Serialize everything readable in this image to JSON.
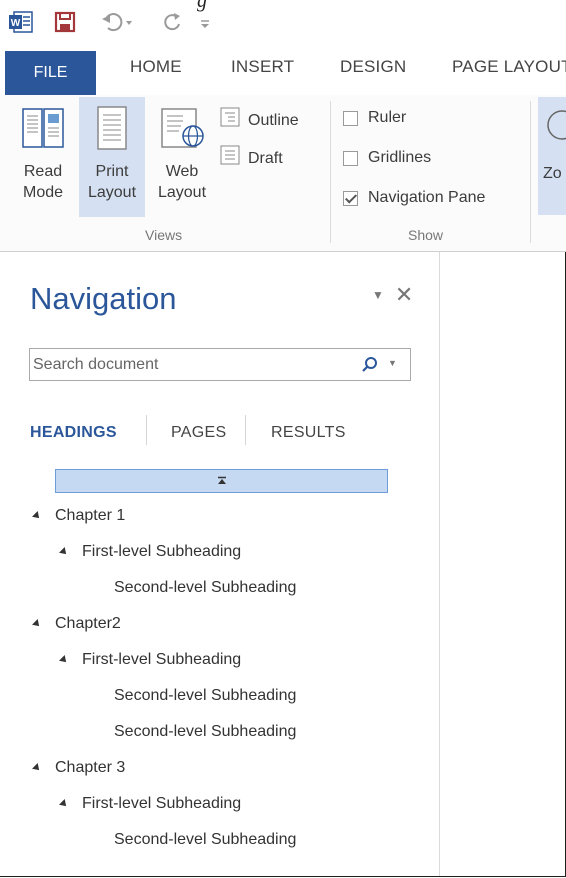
{
  "caption_fragment": "g",
  "colors": {
    "accent": "#2b579a",
    "selected_ribbon": "#d5e1f2",
    "collapse_bar": "#c5daf2"
  },
  "quick_access": [
    {
      "icon": "word-app-icon"
    },
    {
      "icon": "save-icon"
    },
    {
      "icon": "undo-icon"
    },
    {
      "icon": "redo-icon"
    },
    {
      "icon": "customize-toolbar-icon"
    }
  ],
  "tabs": {
    "file": "FILE",
    "home": "HOME",
    "insert": "INSERT",
    "design": "DESIGN",
    "page_layout": "PAGE LAYOUT"
  },
  "ribbon": {
    "views": {
      "read_mode": [
        "Read",
        "Mode"
      ],
      "print_layout": [
        "Print",
        "Layout"
      ],
      "web_layout": [
        "Web",
        "Layout"
      ],
      "outline": "Outline",
      "draft": "Draft",
      "group_label": "Views"
    },
    "show": {
      "ruler": {
        "label": "Ruler",
        "checked": false
      },
      "gridlines": {
        "label": "Gridlines",
        "checked": false
      },
      "navigation_pane": {
        "label": "Navigation Pane",
        "checked": true
      },
      "group_label": "Show"
    },
    "zoom_partial": "Zo"
  },
  "navigation": {
    "title": "Navigation",
    "search": {
      "placeholder": "Search document"
    },
    "tabs": {
      "headings": "HEADINGS",
      "pages": "PAGES",
      "results": "RESULTS"
    },
    "active_tab": "headings",
    "tree": [
      {
        "level": 1,
        "label": "Chapter 1",
        "expanded": true
      },
      {
        "level": 2,
        "label": "First-level Subheading",
        "expanded": true
      },
      {
        "level": 3,
        "label": "Second-level Subheading"
      },
      {
        "level": 1,
        "label": "Chapter2",
        "expanded": true
      },
      {
        "level": 2,
        "label": "First-level Subheading",
        "expanded": true
      },
      {
        "level": 3,
        "label": "Second-level Subheading"
      },
      {
        "level": 3,
        "label": "Second-level Subheading"
      },
      {
        "level": 1,
        "label": "Chapter 3",
        "expanded": true
      },
      {
        "level": 2,
        "label": "First-level Subheading",
        "expanded": true
      },
      {
        "level": 3,
        "label": "Second-level Subheading"
      }
    ]
  }
}
